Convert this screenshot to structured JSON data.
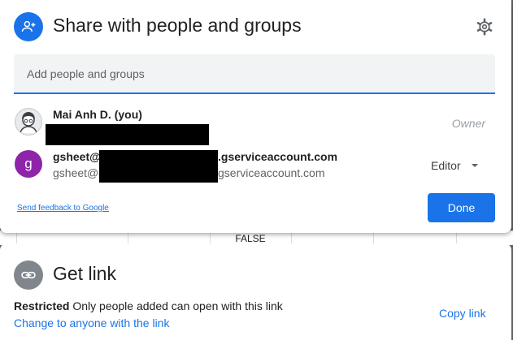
{
  "share_dialog": {
    "title": "Share with people and groups",
    "add_input_placeholder": "Add people and groups",
    "people": [
      {
        "name": "Mai Anh D. (you)",
        "role": "Owner"
      },
      {
        "avatar_letter": "g",
        "name_prefix": "gsheet@",
        "name_suffix": ".gserviceaccount.com",
        "email_prefix": "gsheet@",
        "email_suffix": "gserviceaccount.com",
        "role": "Editor"
      }
    ],
    "feedback_link": "Send feedback to Google",
    "done_label": "Done"
  },
  "sheet_backdrop": {
    "cell_value": "FALSE"
  },
  "get_link": {
    "title": "Get link",
    "restriction_label": "Restricted",
    "restriction_desc": "Only people added can open with this link",
    "change_link": "Change to anyone with the link",
    "copy_link": "Copy link"
  },
  "colors": {
    "accent": "#1a73e8",
    "avatar_purple": "#8e24aa",
    "link_icon_gray": "#80868b",
    "owner_text": "#9aa0a6"
  },
  "icons": {
    "header": "person-add-icon",
    "settings": "gear-icon",
    "dropdown": "caret-down-icon",
    "link": "link-icon"
  }
}
